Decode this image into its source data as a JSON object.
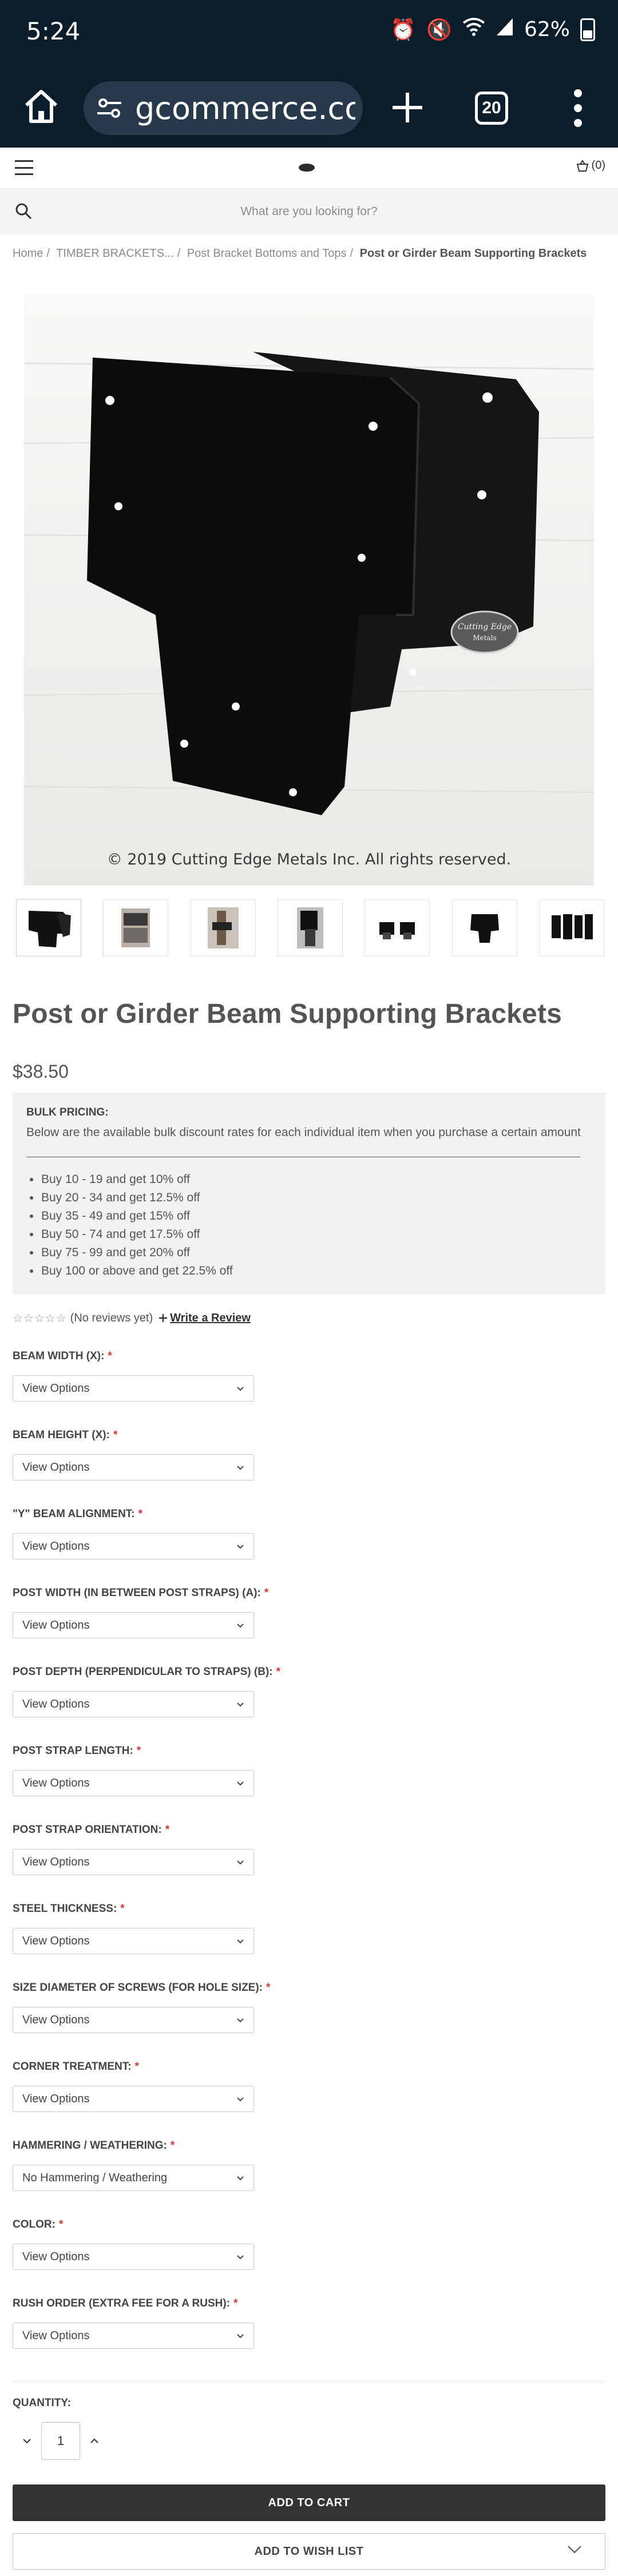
{
  "status_bar": {
    "time": "5:24",
    "battery": "62%"
  },
  "browser": {
    "url": "gcommerce.com",
    "tab_count": "20"
  },
  "header": {
    "cart_count": "(0)"
  },
  "search": {
    "placeholder": "What are you looking for?"
  },
  "breadcrumbs": {
    "items": [
      "Home",
      "TIMBER BRACKETS...",
      "Post Bracket Bottoms and Tops"
    ],
    "current": "Post or Girder Beam Supporting Brackets"
  },
  "main_image": {
    "watermark": "© 2019 Cutting Edge Metals Inc. All rights reserved.",
    "badge": "CUTTING EDGE METALS"
  },
  "thumbnails": [
    "thumb-1",
    "thumb-2",
    "thumb-3",
    "thumb-4",
    "thumb-5",
    "thumb-6",
    "thumb-7"
  ],
  "product": {
    "title": "Post or Girder Beam Supporting Brackets",
    "price": "$38.50"
  },
  "bulk_pricing": {
    "heading": "BULK PRICING:",
    "intro": "Below are the available bulk discount rates for each individual item when you purchase a certain amount",
    "tiers": [
      "Buy 10 - 19 and get 10% off",
      "Buy 20 - 34 and get 12.5% off",
      "Buy 35 - 49 and get 15% off",
      "Buy 50 - 74 and get 17.5% off",
      "Buy 75 - 99 and get 20% off",
      "Buy 100 or above and get 22.5% off"
    ]
  },
  "reviews": {
    "stars": "☆☆☆☆☆",
    "count_text": "(No reviews yet)",
    "write_link": "Write a Review"
  },
  "options": [
    {
      "label": "BEAM WIDTH (X):",
      "required": "*",
      "value": "View Options"
    },
    {
      "label": "BEAM HEIGHT (X):",
      "required": "*",
      "value": "View Options"
    },
    {
      "label": "\"Y\" BEAM ALIGNMENT:",
      "required": "*",
      "value": "View Options"
    },
    {
      "label": "POST WIDTH (IN BETWEEN POST STRAPS) (A):",
      "required": "*",
      "value": "View Options"
    },
    {
      "label": "POST DEPTH (PERPENDICULAR TO STRAPS) (B):",
      "required": "*",
      "value": "View Options"
    },
    {
      "label": "POST STRAP LENGTH:",
      "required": "*",
      "value": "View Options"
    },
    {
      "label": "POST STRAP ORIENTATION:",
      "required": "*",
      "value": "View Options"
    },
    {
      "label": "STEEL THICKNESS:",
      "required": "*",
      "value": "View Options"
    },
    {
      "label": "SIZE DIAMETER OF SCREWS (FOR HOLE SIZE):",
      "required": "*",
      "value": "View Options"
    },
    {
      "label": "CORNER TREATMENT:",
      "required": "*",
      "value": "View Options"
    },
    {
      "label": "HAMMERING / WEATHERING:",
      "required": "*",
      "value": "No Hammering / Weathering"
    },
    {
      "label": "COLOR:",
      "required": "*",
      "value": "View Options"
    },
    {
      "label": "RUSH ORDER (EXTRA FEE FOR A RUSH):",
      "required": "*",
      "value": "View Options"
    }
  ],
  "quantity": {
    "label": "QUANTITY:",
    "value": "1"
  },
  "actions": {
    "add_to_cart": "ADD TO CART",
    "add_to_wishlist": "ADD TO WISH LIST"
  }
}
